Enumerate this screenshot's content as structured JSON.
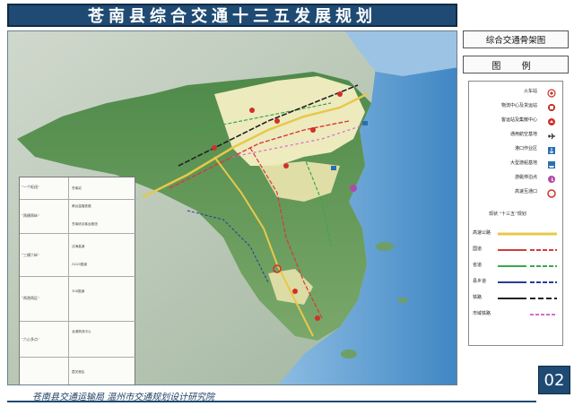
{
  "header": {
    "title": "苍南县综合交通十三五发展规划"
  },
  "sidebar": {
    "subtitle": "综合交通骨架图",
    "legend_title": "图 例",
    "symbols": [
      {
        "label": "火车站",
        "icon": "train-station-icon",
        "color": "#d0302a"
      },
      {
        "label": "物流中心及货运站",
        "icon": "logistics-icon",
        "color": "#c0281e"
      },
      {
        "label": "客运站及集散中心",
        "icon": "bus-station-icon",
        "color": "#d0302a"
      },
      {
        "label": "通用航空基地",
        "icon": "airplane-icon",
        "color": "#333333"
      },
      {
        "label": "港口作业区",
        "icon": "port-icon",
        "color": "#2a6fb0"
      },
      {
        "label": "大型游船基地",
        "icon": "ship-icon",
        "color": "#2a6fb0"
      },
      {
        "label": "游艇停泊点",
        "icon": "yacht-icon",
        "color": "#b04aa8"
      },
      {
        "label": "高速互通口",
        "icon": "interchange-icon",
        "color": "#d0302a"
      }
    ],
    "plan_header": "现状  “十三五”规划",
    "lines": [
      {
        "label": "高速公路",
        "color": "#e8c84a"
      },
      {
        "label": "国道",
        "color": "#d83a3a"
      },
      {
        "label": "省道",
        "color": "#3aa84a"
      },
      {
        "label": "县乡道",
        "color": "#2a3a9a"
      },
      {
        "label": "铁路",
        "color": "#222222"
      },
      {
        "label": "市域铁路",
        "color": "#d86ad0"
      }
    ]
  },
  "map": {
    "sea_color": "#5a9bd0",
    "land_color": "#f5efc4"
  },
  "plan_table": {
    "categories": [
      "“一个枢纽”",
      "“两横两纵”",
      "“三横六纵”",
      "“两港两区”",
      "“六心多点”"
    ],
    "items": [
      "苍南站",
      "甬台温福铁路",
      "苍南综合客运枢纽",
      "沈海高速",
      "G228国道",
      "104国道",
      "龙港物流中心",
      "霞关港区"
    ]
  },
  "footer": {
    "org": "苍南县交通运输局    温州市交通规划设计研究院",
    "page": "02"
  }
}
